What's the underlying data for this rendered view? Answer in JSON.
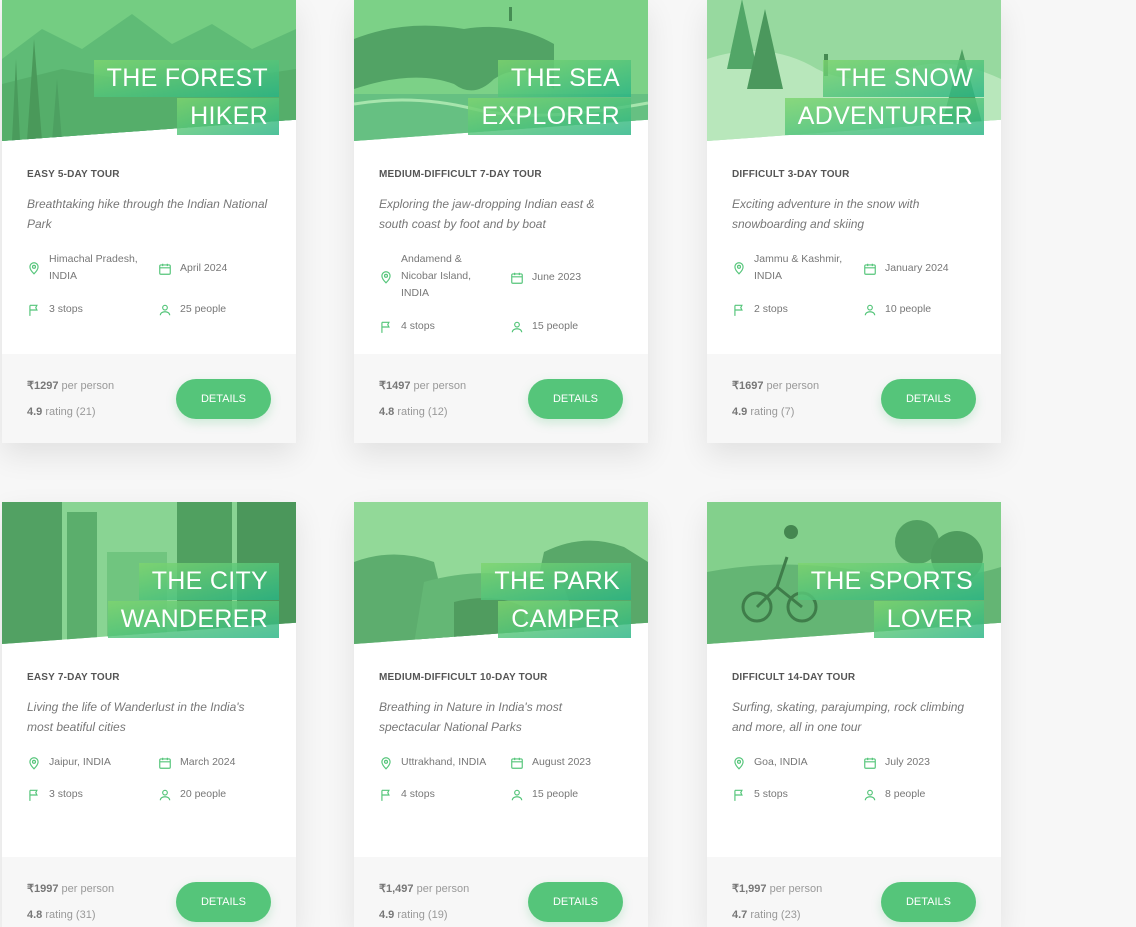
{
  "accent_color": "#55c57a",
  "tours": [
    {
      "title_line1": "The Forest",
      "title_line2": "Hiker",
      "subheading": "Easy 5-day tour",
      "description": "Breathtaking hike through the Indian National Park",
      "location": [
        "Himachal Pradesh,",
        "INDIA"
      ],
      "date": "April 2024",
      "stops": "3 stops",
      "people": "25 people",
      "price": "₹1297",
      "price_suffix": "per person",
      "rating": "4.9",
      "rating_suffix": "rating (21)",
      "button_label": "Details",
      "image_theme": "mountains"
    },
    {
      "title_line1": "The Sea",
      "title_line2": "Explorer",
      "subheading": "Medium-difficult 7-day tour",
      "description": "Exploring the jaw-dropping Indian east & south coast by foot and by boat",
      "location": [
        "Andamend &",
        "Nicobar Island,",
        "INDIA"
      ],
      "date": "June 2023",
      "stops": "4 stops",
      "people": "15 people",
      "price": "₹1497",
      "price_suffix": "per person",
      "rating": "4.8",
      "rating_suffix": "rating (12)",
      "button_label": "Details",
      "image_theme": "sea-arch"
    },
    {
      "title_line1": "The Snow",
      "title_line2": "Adventurer",
      "subheading": "Difficult 3-day tour",
      "description": "Exciting adventure in the snow with snowboarding and skiing",
      "location": [
        "Jammu & Kashmir,",
        "INDIA"
      ],
      "date": "January 2024",
      "stops": "2 stops",
      "people": "10 people",
      "price": "₹1697",
      "price_suffix": "per person",
      "rating": "4.9",
      "rating_suffix": "rating (7)",
      "button_label": "Details",
      "image_theme": "snow"
    },
    {
      "title_line1": "The City",
      "title_line2": "Wanderer",
      "subheading": "Easy 7-day tour",
      "description": "Living the life of Wanderlust in the India's most beatiful cities",
      "location": [
        "Jaipur, INDIA"
      ],
      "date": "March 2024",
      "stops": "3 stops",
      "people": "20 people",
      "price": "₹1997",
      "price_suffix": "per person",
      "rating": "4.8",
      "rating_suffix": "rating (31)",
      "button_label": "Details",
      "image_theme": "city"
    },
    {
      "title_line1": "The Park",
      "title_line2": "Camper",
      "subheading": "Medium-difficult 10-day tour",
      "description": "Breathing in Nature in India's most spectacular National Parks",
      "location": [
        "Uttrakhand, INDIA"
      ],
      "date": "August 2023",
      "stops": "4 stops",
      "people": "15 people",
      "price": "₹1,497",
      "price_suffix": "per person",
      "rating": "4.9",
      "rating_suffix": "rating (19)",
      "button_label": "Details",
      "image_theme": "canyon"
    },
    {
      "title_line1": "The Sports",
      "title_line2": "Lover",
      "subheading": "Difficult 14-day tour",
      "description": "Surfing, skating, parajumping, rock climbing and more, all in one tour",
      "location": [
        "Goa, INDIA"
      ],
      "date": "July 2023",
      "stops": "5 stops",
      "people": "8 people",
      "price": "₹1,997",
      "price_suffix": "per person",
      "rating": "4.7",
      "rating_suffix": "rating (23)",
      "button_label": "Details",
      "image_theme": "bike"
    }
  ]
}
